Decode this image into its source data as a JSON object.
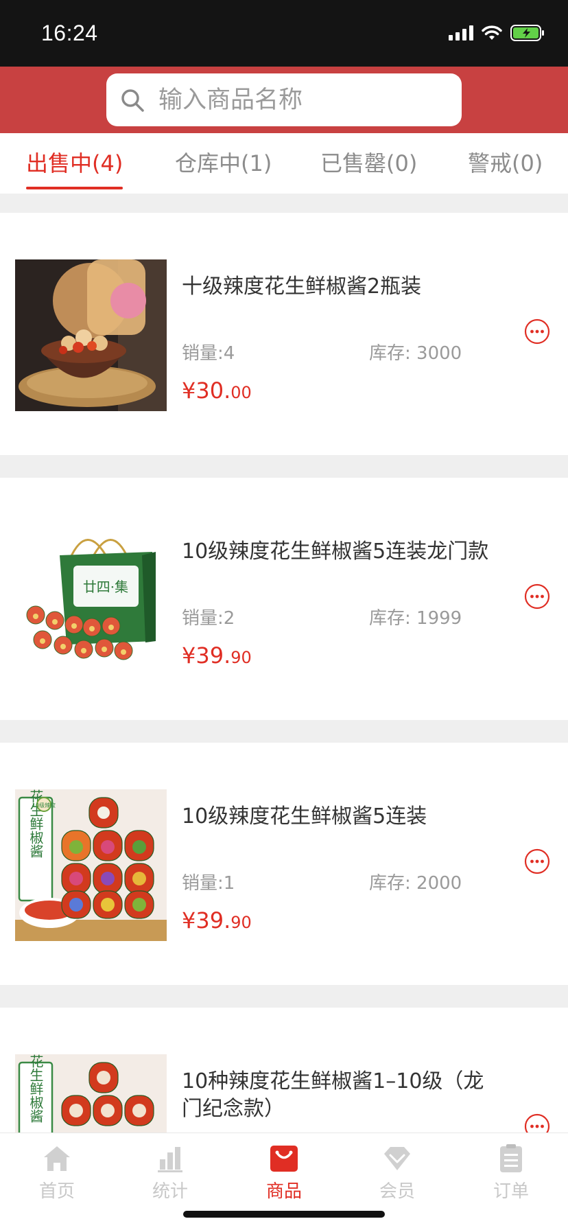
{
  "status_bar": {
    "time": "16:24"
  },
  "search": {
    "placeholder": "输入商品名称"
  },
  "tabs": [
    {
      "label": "出售中(4)",
      "active": true
    },
    {
      "label": "仓库中(1)",
      "active": false
    },
    {
      "label": "已售罄(0)",
      "active": false
    },
    {
      "label": "警戒(0)",
      "active": false
    }
  ],
  "products": [
    {
      "title": "十级辣度花生鲜椒酱2瓶装",
      "sales": "销量:4",
      "stock": "库存: 3000",
      "price_int": "¥30.",
      "price_dec": "00"
    },
    {
      "title": "10级辣度花生鲜椒酱5连装龙门款",
      "sales": "销量:2",
      "stock": "库存: 1999",
      "price_int": "¥39.",
      "price_dec": "90"
    },
    {
      "title": "10级辣度花生鲜椒酱5连装",
      "sales": "销量:1",
      "stock": "库存: 2000",
      "price_int": "¥39.",
      "price_dec": "90"
    },
    {
      "title": "10种辣度花生鲜椒酱1–10级（龙门纪念款）",
      "sales": "",
      "stock": "",
      "price_int": "",
      "price_dec": ""
    }
  ],
  "thumb_text": {
    "bag_brand": "廿四·集",
    "banner_text": "花生鲜椒酱",
    "badge_text": "10级辣度"
  },
  "tabbar": [
    {
      "label": "首页",
      "icon": "home-icon",
      "active": false
    },
    {
      "label": "统计",
      "icon": "stats-icon",
      "active": false
    },
    {
      "label": "商品",
      "icon": "shopping-bag-icon",
      "active": true
    },
    {
      "label": "会员",
      "icon": "member-diamond-icon",
      "active": false
    },
    {
      "label": "订单",
      "icon": "order-list-icon",
      "active": false
    }
  ],
  "colors": {
    "accent": "#e02e24",
    "header": "#c84141",
    "status_bar": "#141414",
    "inactive": "#c8c8c8"
  }
}
